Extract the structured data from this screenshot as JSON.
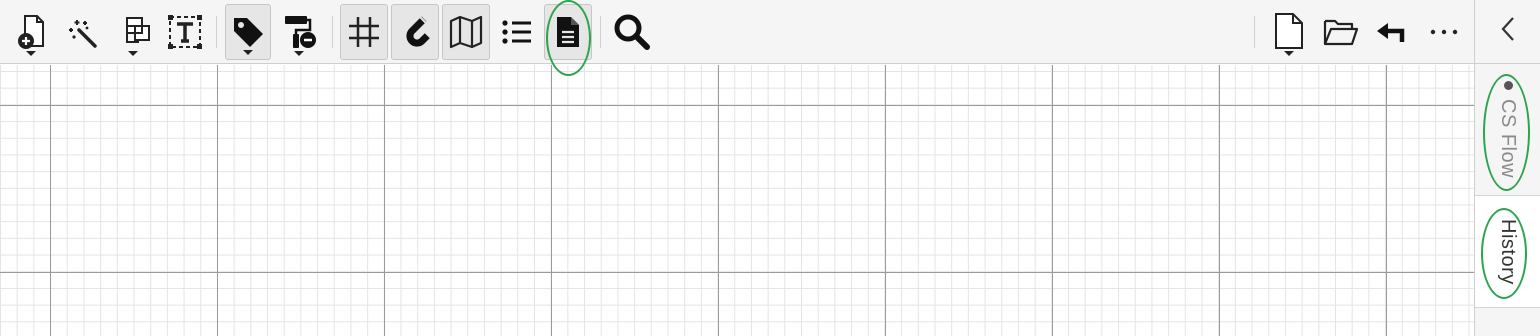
{
  "toolbar": {
    "left_tools": [
      {
        "id": "new-shape",
        "icon": "add-page-icon",
        "has_dropdown": true
      },
      {
        "id": "magic-wand",
        "icon": "magic-wand-icon",
        "has_dropdown": false
      },
      {
        "id": "arrange",
        "icon": "layers-icon",
        "has_dropdown": true
      },
      {
        "id": "text-tool",
        "icon": "text-box-icon",
        "has_dropdown": false
      },
      {
        "id": "tag",
        "icon": "tag-icon",
        "has_dropdown": true,
        "active": true
      },
      {
        "id": "format-paint",
        "icon": "paint-roller-icon",
        "has_dropdown": true
      },
      {
        "id": "grid",
        "icon": "grid-icon",
        "active": true
      },
      {
        "id": "snap",
        "icon": "magnet-icon",
        "active": true
      },
      {
        "id": "map",
        "icon": "map-icon",
        "active": true
      },
      {
        "id": "outline",
        "icon": "list-icon"
      },
      {
        "id": "document",
        "icon": "document-icon",
        "active": true,
        "highlighted": true
      },
      {
        "id": "search",
        "icon": "search-icon"
      }
    ],
    "right_tools": [
      {
        "id": "new-file",
        "icon": "file-icon",
        "has_dropdown": true
      },
      {
        "id": "open",
        "icon": "folder-open-icon"
      },
      {
        "id": "undo",
        "icon": "undo-arrow-icon"
      },
      {
        "id": "more",
        "icon": "more-horizontal-icon"
      }
    ]
  },
  "sidebar": {
    "collapse_icon": "chevron-left-icon",
    "tabs": [
      {
        "label": "CS Flow",
        "indicator": "dot",
        "highlighted": true
      },
      {
        "label": "History",
        "selected": true,
        "highlighted": true
      }
    ]
  },
  "colors": {
    "highlight_ring": "#2ea44f",
    "toolbar_bg": "#f5f5f5",
    "grid_major": "#9a9a9a",
    "grid_minor": "#e4e4e4"
  }
}
